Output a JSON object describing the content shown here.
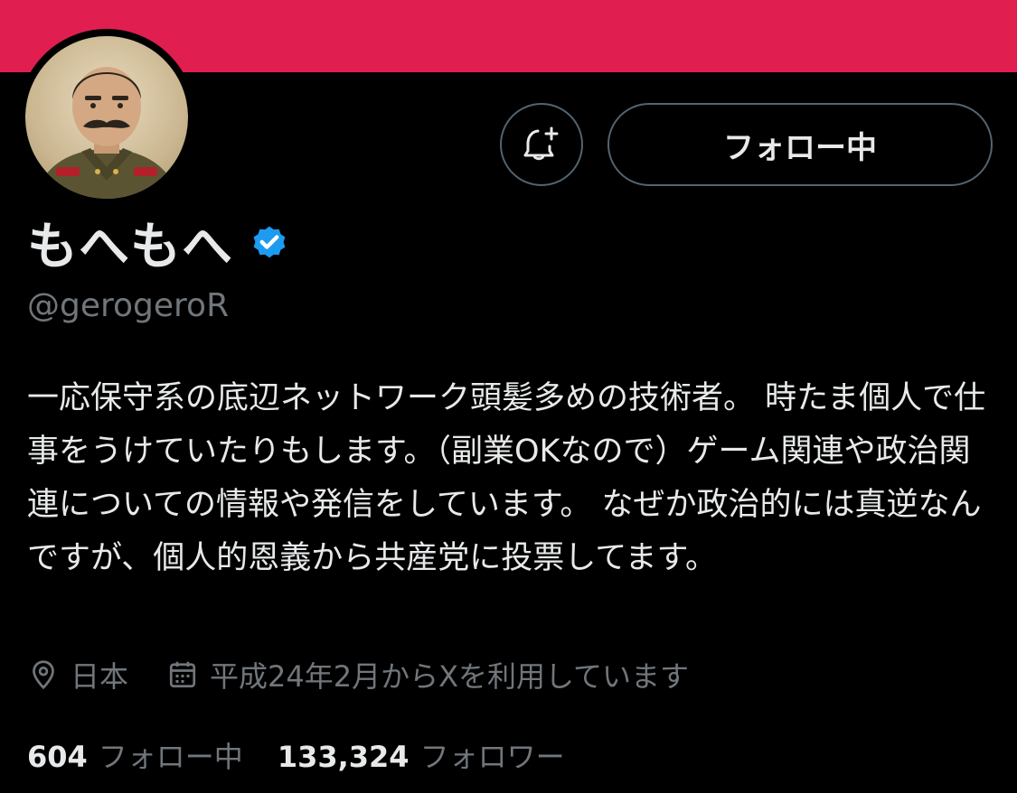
{
  "profile": {
    "display_name": "もへもへ",
    "handle": "@gerogeroR",
    "bio": "一応保守系の底辺ネットワーク頭髪多めの技術者。 時たま個人で仕事をうけていたりもします。（副業OKなので）ゲーム関連や政治関連についての情報や発信をしています。 なぜか政治的には真逆なんですが、個人的恩義から共産党に投票してます。",
    "location": "日本",
    "joined": "平成24年2月からXを利用しています"
  },
  "actions": {
    "follow_label": "フォロー中",
    "notify_icon": "bell-plus-icon"
  },
  "stats": {
    "following_count": "604",
    "following_label": "フォロー中",
    "followers_count": "133,324",
    "followers_label": "フォロワー"
  },
  "colors": {
    "banner": "#e01e50",
    "background": "#000000",
    "primary_text": "#e7e9ea",
    "secondary_text": "#71767b",
    "verified_badge": "#1d9bf0",
    "button_border": "#536471"
  }
}
